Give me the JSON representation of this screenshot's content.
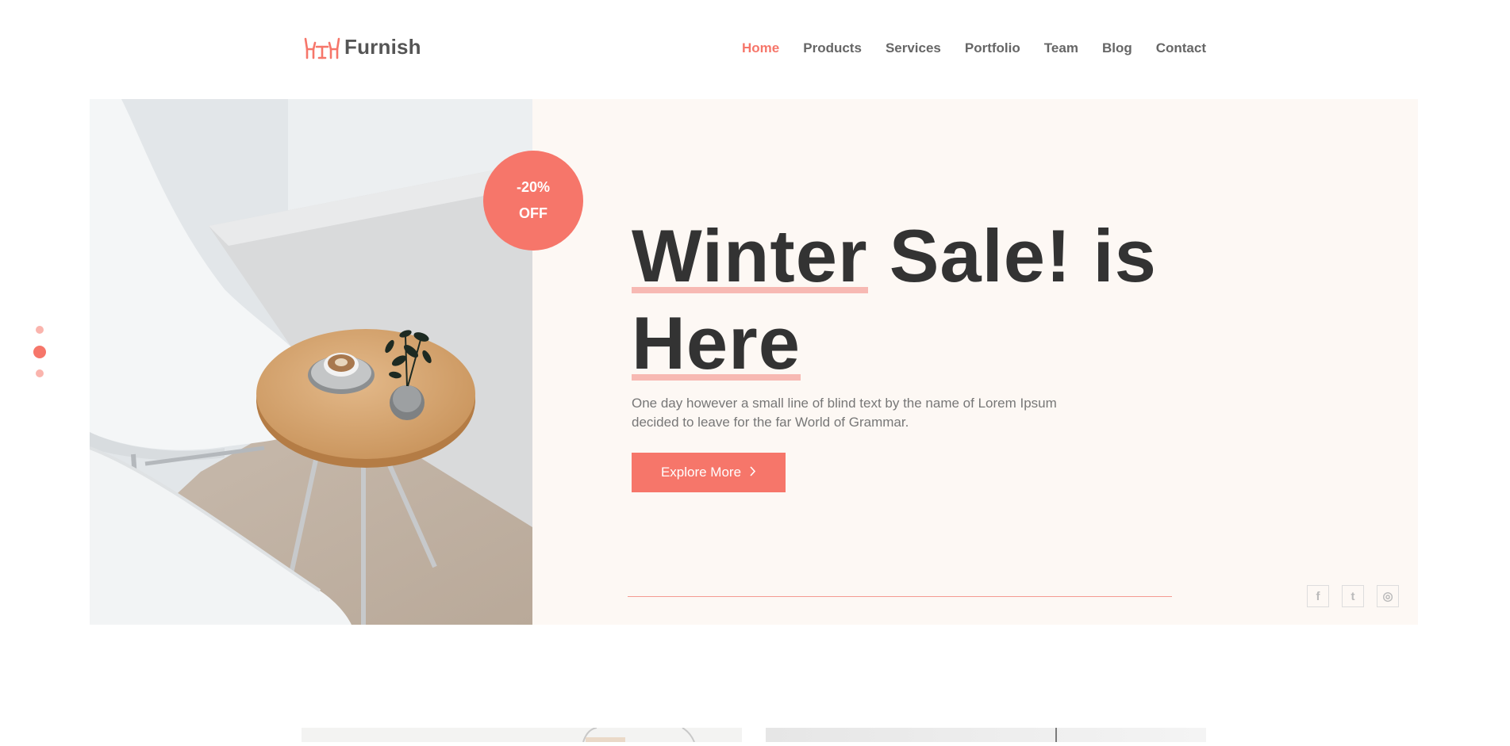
{
  "brand": {
    "name": "Furnish",
    "accent": "#f6766a",
    "logo_icon": "furniture-icon"
  },
  "nav": [
    {
      "label": "Home",
      "active": true
    },
    {
      "label": "Products"
    },
    {
      "label": "Services"
    },
    {
      "label": "Portfolio"
    },
    {
      "label": "Team"
    },
    {
      "label": "Blog"
    },
    {
      "label": "Contact"
    }
  ],
  "hero": {
    "badge_line1": "-20%",
    "badge_line2": "OFF",
    "headline_part1": "Winter",
    "headline_part2": " Sale! is ",
    "headline_part3": "Here",
    "description": "One day however a small line of blind text by the name of Lorem Ipsum decided to leave for the far World of Grammar.",
    "button_label": "Explore More",
    "image_alt": "white chairs with round wooden side table",
    "background": "#fdf8f4"
  },
  "social": [
    {
      "icon": "facebook-icon",
      "glyph": "f"
    },
    {
      "icon": "twitter-icon",
      "glyph": "t"
    },
    {
      "icon": "instagram-icon",
      "glyph": "◎"
    }
  ],
  "slider": {
    "slides": 3,
    "active_index": 1
  }
}
